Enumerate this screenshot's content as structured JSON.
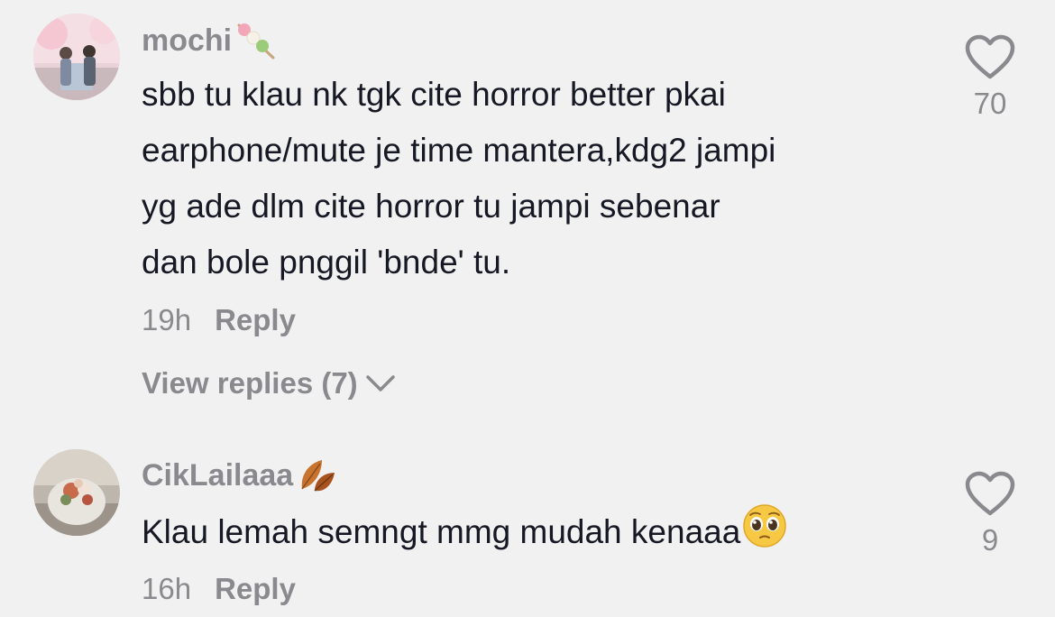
{
  "comments": [
    {
      "username": "mochi",
      "username_icon": "dango-icon",
      "text_lines": [
        "sbb tu klau nk tgk cite horror better pkai",
        "earphone/mute je time mantera,kdg2 jampi",
        "yg ade dlm cite horror tu jampi sebenar",
        "dan bole pnggil 'bnde' tu."
      ],
      "time": "19h",
      "reply_label": "Reply",
      "view_replies_label": "View replies (7)",
      "like_count": "70"
    },
    {
      "username": "CikLailaaa",
      "username_icon": "fallen-leaf-icon",
      "text": "Klau lemah semngt mmg mudah kenaaa",
      "text_emoji": "pleading-face-emoji",
      "time": "16h",
      "reply_label": "Reply",
      "like_count": "9"
    }
  ],
  "colors": {
    "background": "#f1f1f2",
    "primary_text": "#161823",
    "secondary_text": "#8a8a8e"
  }
}
